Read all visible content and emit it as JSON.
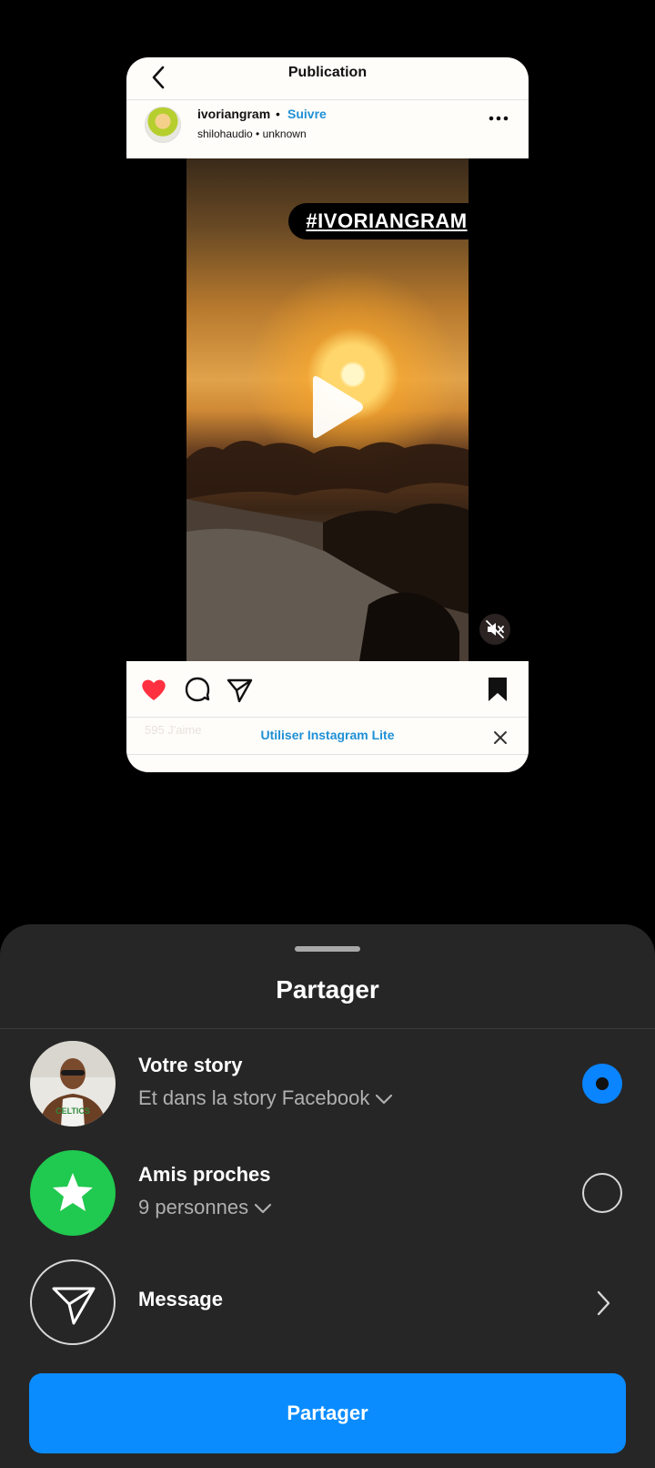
{
  "post": {
    "header_title": "Publication",
    "username": "ivoriangram",
    "separator": "•",
    "follow_label": "Suivre",
    "subtitle": "shilohaudio • unknown",
    "hashtag_hash": "#",
    "hashtag_text": "IVORIANGRAM",
    "likes_faded": "595 J'aime",
    "lite_banner": "Utiliser Instagram Lite",
    "liked": true
  },
  "share_sheet": {
    "title": "Partager",
    "options": [
      {
        "title": "Votre story",
        "subtitle": "Et dans la story Facebook",
        "selected": true,
        "icon": "user-avatar"
      },
      {
        "title": "Amis proches",
        "subtitle": "9 personnes",
        "selected": false,
        "icon": "star-icon"
      },
      {
        "title": "Message",
        "icon": "send-icon"
      }
    ],
    "button_label": "Partager"
  },
  "colors": {
    "accent_blue": "#0a8cff",
    "link_blue": "#1e90d6",
    "like_red": "#ff3040",
    "close_friends_green": "#20c94f",
    "sheet_bg": "#262626"
  }
}
